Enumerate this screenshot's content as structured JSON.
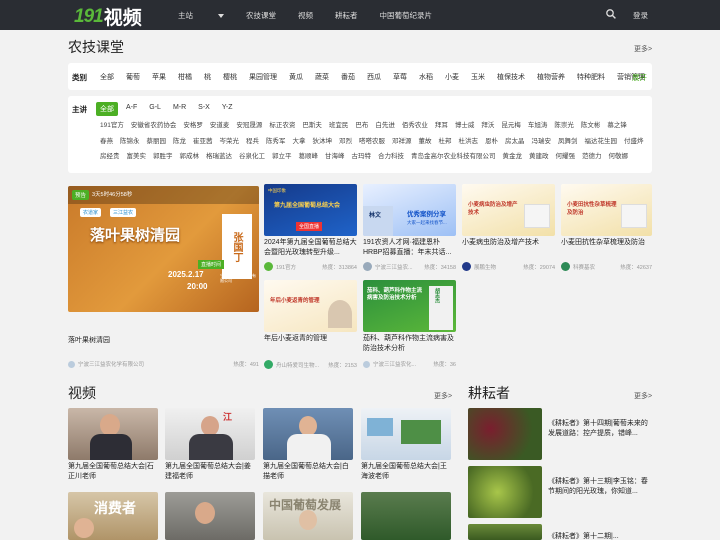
{
  "header": {
    "logo_num": "191",
    "logo_text": "视频",
    "nav": [
      "主站",
      "农技课堂",
      "视频",
      "耕耘者",
      "中国葡萄纪录片"
    ],
    "login": "登录"
  },
  "course": {
    "title": "农技课堂",
    "more": "更多>",
    "category_label": "类别",
    "categories": [
      "全部",
      "葡萄",
      "苹果",
      "柑橘",
      "桃",
      "樱桃",
      "果园管理",
      "黄瓜",
      "蔬菜",
      "番茄",
      "西瓜",
      "草莓",
      "水稻",
      "小麦",
      "玉米",
      "植保技术",
      "植物营养",
      "特种肥料",
      "营销管理"
    ],
    "expand": "展开",
    "speaker_label": "主讲",
    "letters": [
      "全部",
      "A-F",
      "G-L",
      "M-R",
      "S-X",
      "Y-Z"
    ],
    "speakers": [
      "191官方",
      "安徽省农药协会",
      "安格罗",
      "安道麦",
      "安冠晟源",
      "标正农资",
      "巴斯夫",
      "班宜民",
      "巴布",
      "白先进",
      "佰秀农业",
      "拜耳",
      "博士威",
      "拜沃",
      "昆元梅",
      "车旭涛",
      "陈崇光",
      "陈文彬",
      "慕之锋",
      "春燕",
      "陈锦永",
      "蔡丽园",
      "陈龙",
      "崔亚茜",
      "岑荣光",
      "程兵",
      "陈秀军",
      "大拿",
      "狄沐坤",
      "邓烈",
      "嗒嗒农服",
      "邓祥源",
      "董故",
      "杜邦",
      "杜洪志",
      "恩朴",
      "房太晶",
      "冯瑞安",
      "凤舞剑",
      "福达花生园",
      "付盛烨",
      "房经贵",
      "富美实",
      "郭胜宇",
      "郭成林",
      "格瑞蓝达",
      "谷泉化工",
      "郭立平",
      "葛顺峰",
      "甘海峰",
      "古玛特",
      "合力科技",
      "青岛金高尔农业科技有限公司",
      "黄金龙",
      "黄建政",
      "何耀强",
      "范德力",
      "何敬娜"
    ]
  },
  "featured": {
    "badge": "预告",
    "countdown": "3天5时46分58秒",
    "poster_title": "落叶果树清园",
    "poster_speaker": "张国丁",
    "poster_tag": "直播时间",
    "poster_date": "2025.2.17",
    "poster_time": "20:00",
    "poster_org": "宁波三江益农化学有限公司",
    "logo_a": "农道家",
    "logo_b": "三江益农",
    "title": "落叶果树清园",
    "org": "宁波三江益农化学有限公司",
    "hot": "热度：491"
  },
  "cards": [
    {
      "title": "2024年第九届全国葡萄总结大会暨阳光玫瑰转型升级...",
      "org": "191官方",
      "hot": "热度：313864",
      "img_top": "中国印象",
      "img_main": "第九届全国葡萄总结大会",
      "img_sub": "全国直播"
    },
    {
      "title": "191农资人才网·福建恩朴HRBP招募直播：年末共话...",
      "org": "宁波三江益农...",
      "hot": "热度：34158",
      "img_name": "林文",
      "img_main": "优秀案例分享",
      "img_sub": "大家一起来找春节..."
    },
    {
      "title": "小麦病虫防治及增产技术",
      "org": "展鹏生物",
      "hot": "热度：29074",
      "img_main": "小麦病虫防治及增产技术"
    },
    {
      "title": "小麦田抗性杂草梳理及防治",
      "org": "科赛基农",
      "hot": "热度：42637",
      "img_main": "小麦田抗性杂草梳理及防治"
    },
    {
      "title": "年后小麦返青的管理",
      "org": "舟山特爱司生物...",
      "hot": "热度：2153",
      "img_main": "年后小麦返青的管理"
    },
    {
      "title": "茄科、葫芦科作物主流病害及防治技术分析",
      "org": "宁波三江益农化...",
      "hot": "热度：36",
      "img_main": "茄科、葫芦科作物主流病害及防治技术分析",
      "img_name": "胡志杰"
    }
  ],
  "videos": {
    "title": "视频",
    "more": "更多>",
    "items": [
      {
        "title": "第九届全国葡萄总结大会|石正川老师"
      },
      {
        "title": "第九届全国葡萄总结大会|姜建福老师"
      },
      {
        "title": "第九届全国葡萄总结大会|白描老师"
      },
      {
        "title": "第九届全国葡萄总结大会|王海波老师"
      }
    ],
    "row2_text_a": "消费者",
    "row2_text_b": "中国葡萄发展"
  },
  "gengyun": {
    "title": "耕耘者",
    "more": "更多>",
    "items": [
      {
        "title": "《耕耘者》第十四期|葡萄未来的发展道路：控产提质，错峰..."
      },
      {
        "title": "《耕耘者》第十三期|李玉铭：春节期间的阳光玫瑰，你知道..."
      },
      {
        "title": "《耕耘者》第十二期|..."
      }
    ]
  },
  "colors": {
    "accent": "#4caf24",
    "header": "#2a2d33"
  }
}
